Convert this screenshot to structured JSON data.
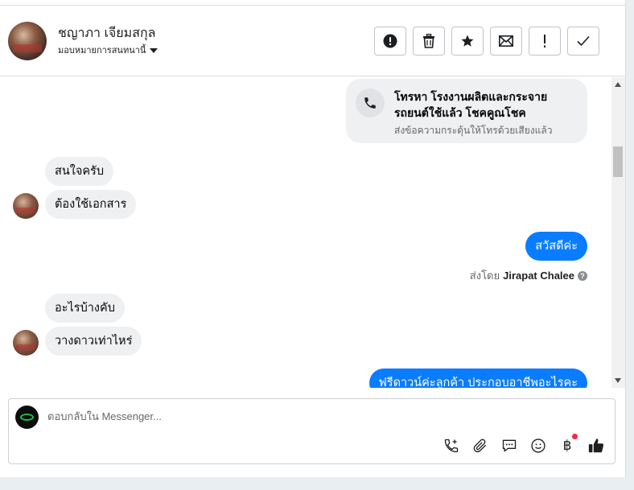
{
  "header": {
    "name": "ชญาภา เจียมสกุล",
    "assign_label": "มอบหมายการสนทนานี้",
    "actions": [
      {
        "name": "spam-button",
        "icon": "alert-circle-icon"
      },
      {
        "name": "delete-button",
        "icon": "trash-icon"
      },
      {
        "name": "star-button",
        "icon": "star-icon"
      },
      {
        "name": "mark-unread-button",
        "icon": "envelope-icon"
      },
      {
        "name": "follow-up-button",
        "icon": "exclamation-icon"
      },
      {
        "name": "mark-done-button",
        "icon": "check-icon"
      }
    ]
  },
  "messages": {
    "call_card": {
      "title": "โทรหา โรงงานผลิตและกระจายรถยนต์ใช้แล้ว โชคคูณโชค",
      "subtitle": "ส่งข้อความกระตุ้นให้โทรด้วยเสียงแล้ว"
    },
    "incoming_1": "สนใจครับ",
    "incoming_2": "ต้องใช้เอกสาร",
    "outgoing_1": "สวัสดีค่ะ",
    "sent_by_prefix": "ส่งโดย",
    "sent_by_name": "Jirapat Chalee",
    "incoming_3": "อะไรบ้างคับ",
    "incoming_4": "วางดาวเท่าไหร่",
    "outgoing_2": "ฟรีดาวน์ค่ะลูกค้า ประกอบอาชีพอะไรคะ"
  },
  "composer": {
    "placeholder": "ตอบกลับใน Messenger...",
    "tools": [
      "phone-plus-icon",
      "paperclip-icon",
      "saved-reply-icon",
      "emoji-icon",
      "baht-payment-icon",
      "thumbs-up-icon"
    ],
    "baht_symbol": "฿"
  },
  "colors": {
    "accent": "#0a7cff",
    "incoming_bubble": "#eff0f2",
    "notification_dot": "#f02849"
  }
}
